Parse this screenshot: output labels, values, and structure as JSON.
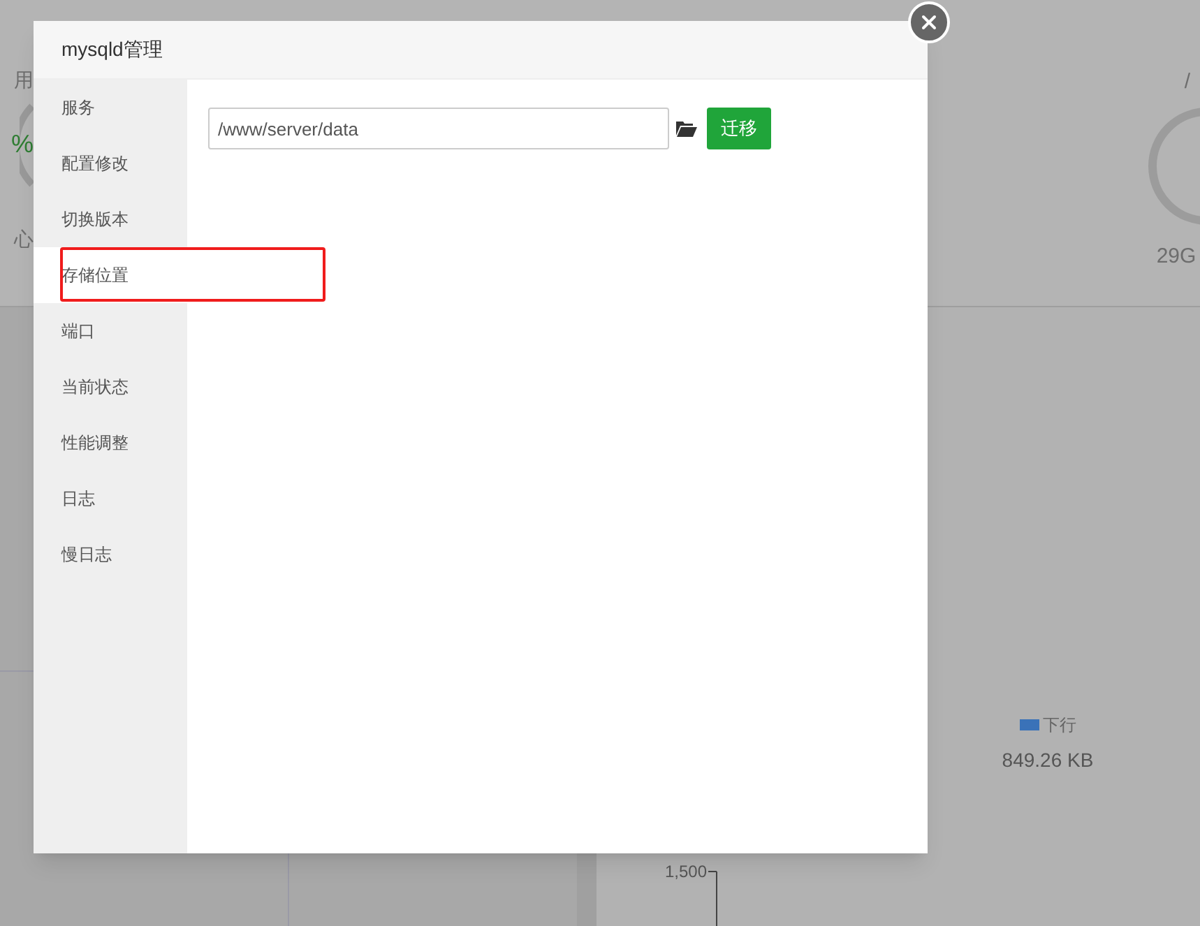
{
  "background": {
    "left_card": {
      "label": "用",
      "percent": "%",
      "caption": "心"
    },
    "right_card": {
      "label": "/",
      "caption": "29G"
    },
    "network": {
      "legend": "下行",
      "value": "849.26 KB",
      "y_tick": "1,500"
    }
  },
  "dialog": {
    "title": "mysqld管理",
    "menu": [
      {
        "label": "服务",
        "selected": false,
        "highlighted": false
      },
      {
        "label": "配置修改",
        "selected": false,
        "highlighted": false
      },
      {
        "label": "切换版本",
        "selected": false,
        "highlighted": false
      },
      {
        "label": "存储位置",
        "selected": true,
        "highlighted": true
      },
      {
        "label": "端口",
        "selected": false,
        "highlighted": false
      },
      {
        "label": "当前状态",
        "selected": false,
        "highlighted": false
      },
      {
        "label": "性能调整",
        "selected": false,
        "highlighted": false
      },
      {
        "label": "日志",
        "selected": false,
        "highlighted": false
      },
      {
        "label": "慢日志",
        "selected": false,
        "highlighted": false
      }
    ],
    "path_field": {
      "value": "/www/server/data"
    },
    "migrate_button": "迁移"
  }
}
